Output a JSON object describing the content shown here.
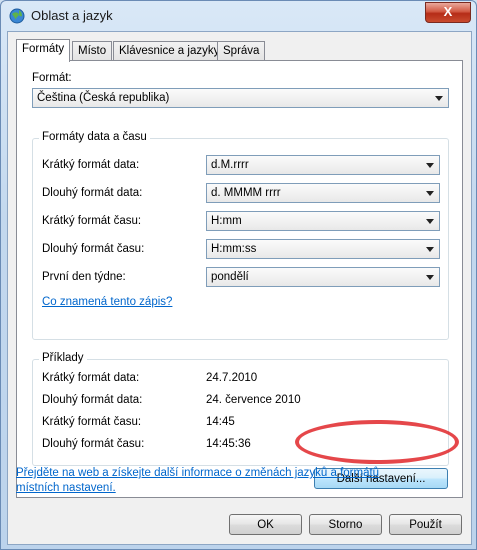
{
  "window": {
    "title": "Oblast a jazyk",
    "close_glyph": "X"
  },
  "tabs": [
    "Formáty",
    "Místo",
    "Klávesnice a jazyky",
    "Správa"
  ],
  "format": {
    "label": "Formát:",
    "value": "Čeština (Česká republika)"
  },
  "date_time": {
    "title": "Formáty data a času",
    "rows": [
      {
        "label": "Krátký formát data:",
        "value": "d.M.rrrr"
      },
      {
        "label": "Dlouhý formát data:",
        "value": "d. MMMM rrrr"
      },
      {
        "label": "Krátký formát času:",
        "value": "H:mm"
      },
      {
        "label": "Dlouhý formát času:",
        "value": "H:mm:ss"
      },
      {
        "label": "První den týdne:",
        "value": "pondělí"
      }
    ],
    "help_link": "Co znamená tento zápis?"
  },
  "examples": {
    "title": "Příklady",
    "rows": [
      {
        "label": "Krátký formát data:",
        "value": "24.7.2010"
      },
      {
        "label": "Dlouhý formát data:",
        "value": "24. července 2010"
      },
      {
        "label": "Krátký formát času:",
        "value": "14:45"
      },
      {
        "label": "Dlouhý formát času:",
        "value": "14:45:36"
      }
    ]
  },
  "more_settings_button": "Další nastavení...",
  "web_link": {
    "line1": "Přejděte na web a získejte další informace o změnách jazyků a formátů",
    "line2": "místních nastavení."
  },
  "footer": {
    "ok": "OK",
    "cancel": "Storno",
    "apply": "Použít"
  },
  "colors": {
    "link": "#0066cc",
    "highlight_ellipse": "#e0272a"
  }
}
